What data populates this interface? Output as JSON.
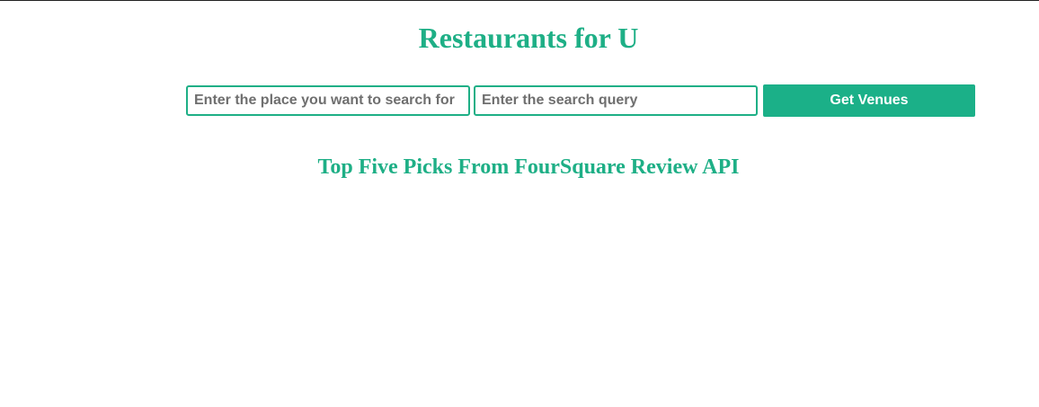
{
  "header": {
    "title": "Restaurants for U"
  },
  "search": {
    "place_placeholder": "Enter the place you want to search for",
    "query_placeholder": "Enter the search query",
    "button_label": "Get Venues"
  },
  "results": {
    "heading": "Top Five Picks From FourSquare Review API"
  },
  "colors": {
    "accent": "#1eaf86",
    "button_bg": "#1bb088",
    "button_text": "#ffffff"
  }
}
